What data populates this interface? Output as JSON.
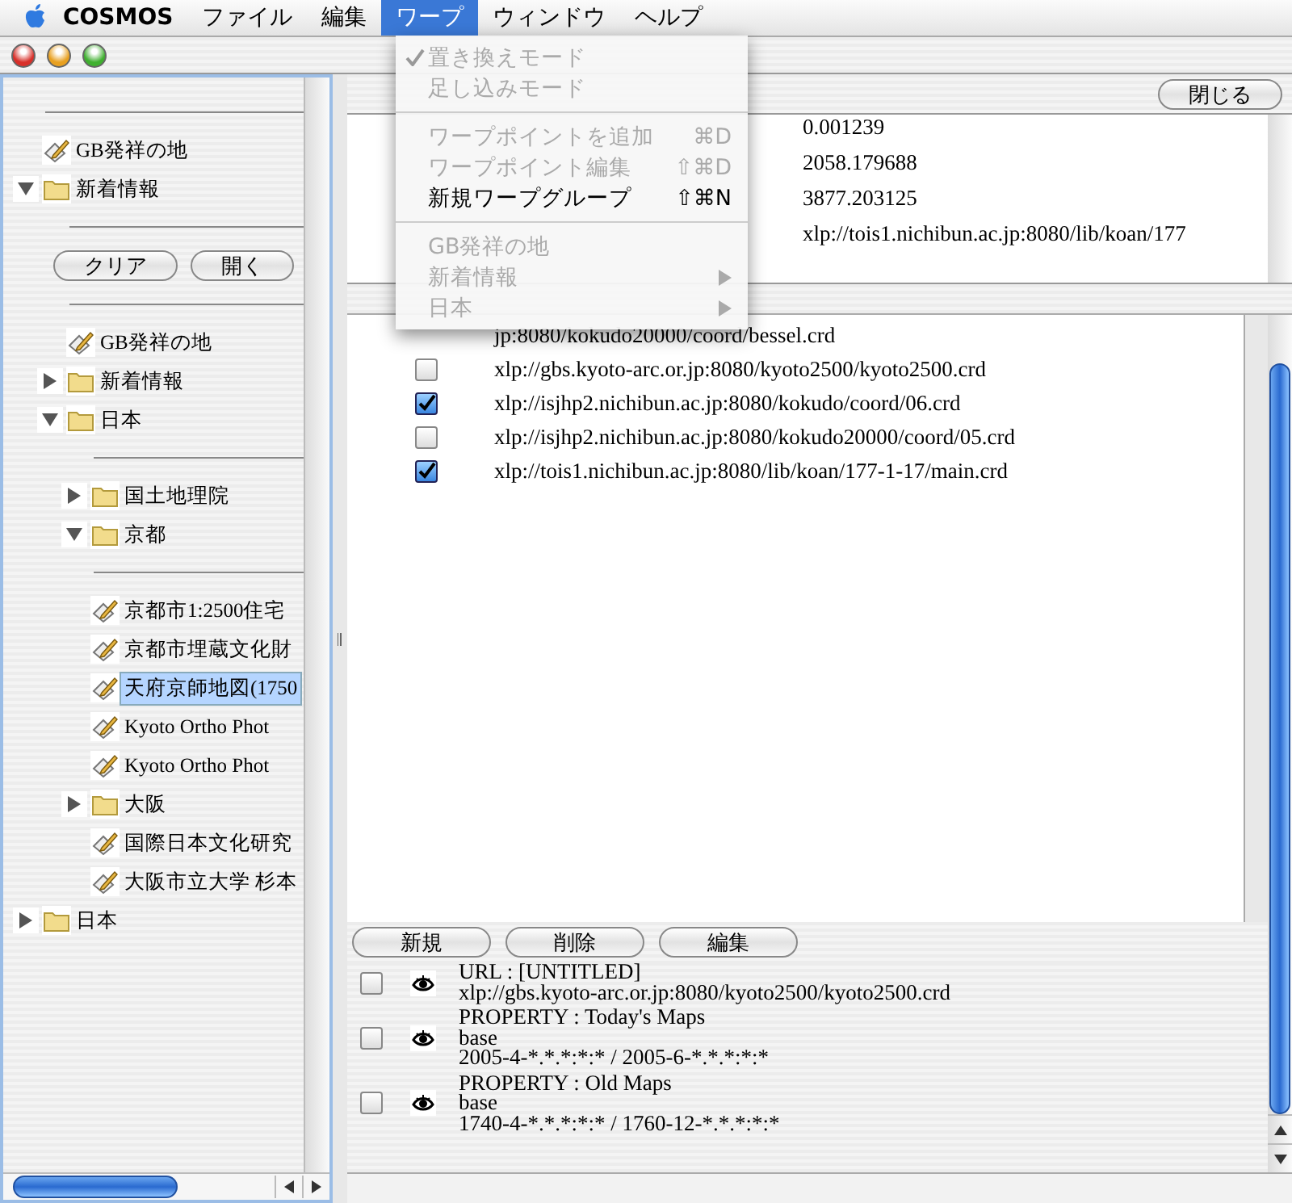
{
  "menubar": {
    "app": "COSMOS",
    "menus": [
      {
        "label": "ファイル",
        "selected": false
      },
      {
        "label": "編集",
        "selected": false
      },
      {
        "label": "ワープ",
        "selected": true
      },
      {
        "label": "ウィンドウ",
        "selected": false
      },
      {
        "label": "ヘルプ",
        "selected": false
      }
    ]
  },
  "open_menu": {
    "items": [
      {
        "kind": "item",
        "label": "置き換えモード",
        "checked": true,
        "disabled": true
      },
      {
        "kind": "item",
        "label": "足し込みモード",
        "checked": false,
        "disabled": true
      },
      {
        "kind": "separator"
      },
      {
        "kind": "item",
        "label": "ワープポイントを追加",
        "shortcut": "⌘D",
        "checked": false,
        "disabled": true
      },
      {
        "kind": "item",
        "label": "ワープポイント編集",
        "shortcut": "⇧⌘D",
        "checked": false,
        "disabled": true
      },
      {
        "kind": "item",
        "label": "新規ワープグループ",
        "shortcut": "⇧⌘N",
        "checked": false,
        "disabled": false
      },
      {
        "kind": "separator"
      },
      {
        "kind": "item",
        "label": "GB発祥の地",
        "checked": false,
        "disabled": true
      },
      {
        "kind": "submenu",
        "label": "新着情報",
        "disabled": true
      },
      {
        "kind": "submenu",
        "label": "日本",
        "disabled": true
      }
    ]
  },
  "tree": [
    {
      "kind": "rule"
    },
    {
      "kind": "leaf",
      "label": "GB発祥の地",
      "selected": false
    },
    {
      "kind": "folder",
      "label": "新着情報",
      "expanded": true,
      "children": [
        {
          "kind": "rule"
        },
        {
          "kind": "buttons",
          "labels": [
            "クリア",
            "開く"
          ]
        },
        {
          "kind": "rule"
        },
        {
          "kind": "leaf",
          "label": "GB発祥の地",
          "selected": false
        },
        {
          "kind": "folder",
          "label": "新着情報",
          "expanded": false
        },
        {
          "kind": "folder",
          "label": "日本",
          "expanded": true,
          "children": [
            {
              "kind": "rule"
            },
            {
              "kind": "folder",
              "label": "国土地理院",
              "expanded": false
            },
            {
              "kind": "folder",
              "label": "京都",
              "expanded": true,
              "children": [
                {
                  "kind": "rule"
                },
                {
                  "kind": "leaf",
                  "label": "京都市1:2500住宅",
                  "selected": false
                },
                {
                  "kind": "leaf",
                  "label": "京都市埋蔵文化財",
                  "selected": false
                },
                {
                  "kind": "leaf",
                  "label": "天府京師地図(1750",
                  "selected": true
                },
                {
                  "kind": "leaf",
                  "label": "Kyoto Ortho Phot",
                  "selected": false
                },
                {
                  "kind": "leaf",
                  "label": "Kyoto Ortho Phot",
                  "selected": false
                }
              ]
            },
            {
              "kind": "folder",
              "label": "大阪",
              "expanded": false
            },
            {
              "kind": "leaf",
              "label": "国際日本文化研究",
              "selected": false
            },
            {
              "kind": "leaf",
              "label": "大阪市立大学 杉本",
              "selected": false
            }
          ]
        }
      ]
    },
    {
      "kind": "folder",
      "label": "日本",
      "expanded": false
    }
  ],
  "close_button": "閉じる",
  "properties": [
    "0.001239",
    "2058.179688",
    "3877.203125",
    "xlp://tois1.nichibun.ac.jp:8080/lib/koan/177"
  ],
  "url_list": {
    "partial_row": "jp:8080/kokudo20000/coord/bessel.crd",
    "rows": [
      {
        "url": "xlp://gbs.kyoto-arc.or.jp:8080/kyoto2500/kyoto2500.crd",
        "checked": false
      },
      {
        "url": "xlp://isjhp2.nichibun.ac.jp:8080/kokudo/coord/06.crd",
        "checked": true
      },
      {
        "url": "xlp://isjhp2.nichibun.ac.jp:8080/kokudo20000/coord/05.crd",
        "checked": false
      },
      {
        "url": "xlp://tois1.nichibun.ac.jp:8080/lib/koan/177-1-17/main.crd",
        "checked": true
      }
    ]
  },
  "group_buttons": [
    "新規",
    "削除",
    "編集"
  ],
  "entries": [
    {
      "checked": false,
      "lines": [
        "URL : [UNTITLED]",
        "xlp://gbs.kyoto-arc.or.jp:8080/kyoto2500/kyoto2500.crd"
      ]
    },
    {
      "checked": false,
      "lines": [
        "PROPERTY : Today's Maps",
        "base",
        "2005-4-*.*.*:*:* / 2005-6-*.*.*:*:*"
      ]
    },
    {
      "checked": false,
      "lines": [
        "PROPERTY : Old Maps",
        "base",
        "1740-4-*.*.*:*:* / 1760-12-*.*.*:*:*"
      ]
    }
  ]
}
